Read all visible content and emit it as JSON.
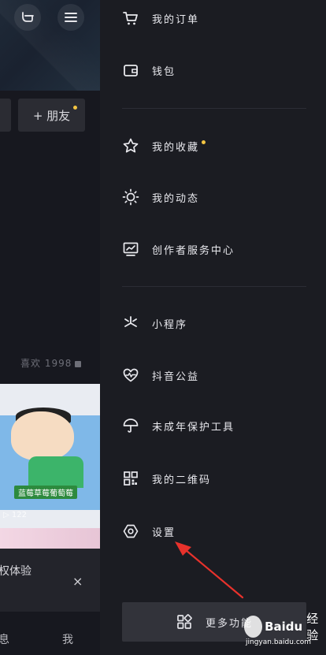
{
  "left_page": {
    "add_friend_label": "+ 朋友",
    "likes_label": "喜欢 1998",
    "thumbnail_caption": "蓝莓草莓葡萄莓",
    "thumbnail_views": "122",
    "notice_text": "权体验",
    "notice_close": "×",
    "tab_message": "息",
    "tab_me": "我"
  },
  "drawer": {
    "items": [
      {
        "label": "我的订单",
        "icon": "cart-icon"
      },
      {
        "label": "钱包",
        "icon": "wallet-icon"
      },
      {
        "label": "我的收藏",
        "icon": "star-icon",
        "badge_color": "#f4c542"
      },
      {
        "label": "我的动态",
        "icon": "sun-icon"
      },
      {
        "label": "创作者服务中心",
        "icon": "creator-chart-icon"
      },
      {
        "label": "小程序",
        "icon": "mini-program-icon"
      },
      {
        "label": "抖音公益",
        "icon": "charity-heart-icon"
      },
      {
        "label": "未成年保护工具",
        "icon": "umbrella-icon"
      },
      {
        "label": "我的二维码",
        "icon": "qrcode-icon"
      },
      {
        "label": "设置",
        "icon": "settings-hexagon-icon"
      }
    ],
    "more_label": "更多功能"
  },
  "annotation": {
    "color": "#e8322c"
  },
  "watermark": {
    "brand": "Baidu",
    "suffix": "经验",
    "url": "jingyan.baidu.com"
  },
  "colors": {
    "background": "#1b1c22",
    "accent_dot": "#f4c542",
    "text": "#e9e9ee"
  }
}
